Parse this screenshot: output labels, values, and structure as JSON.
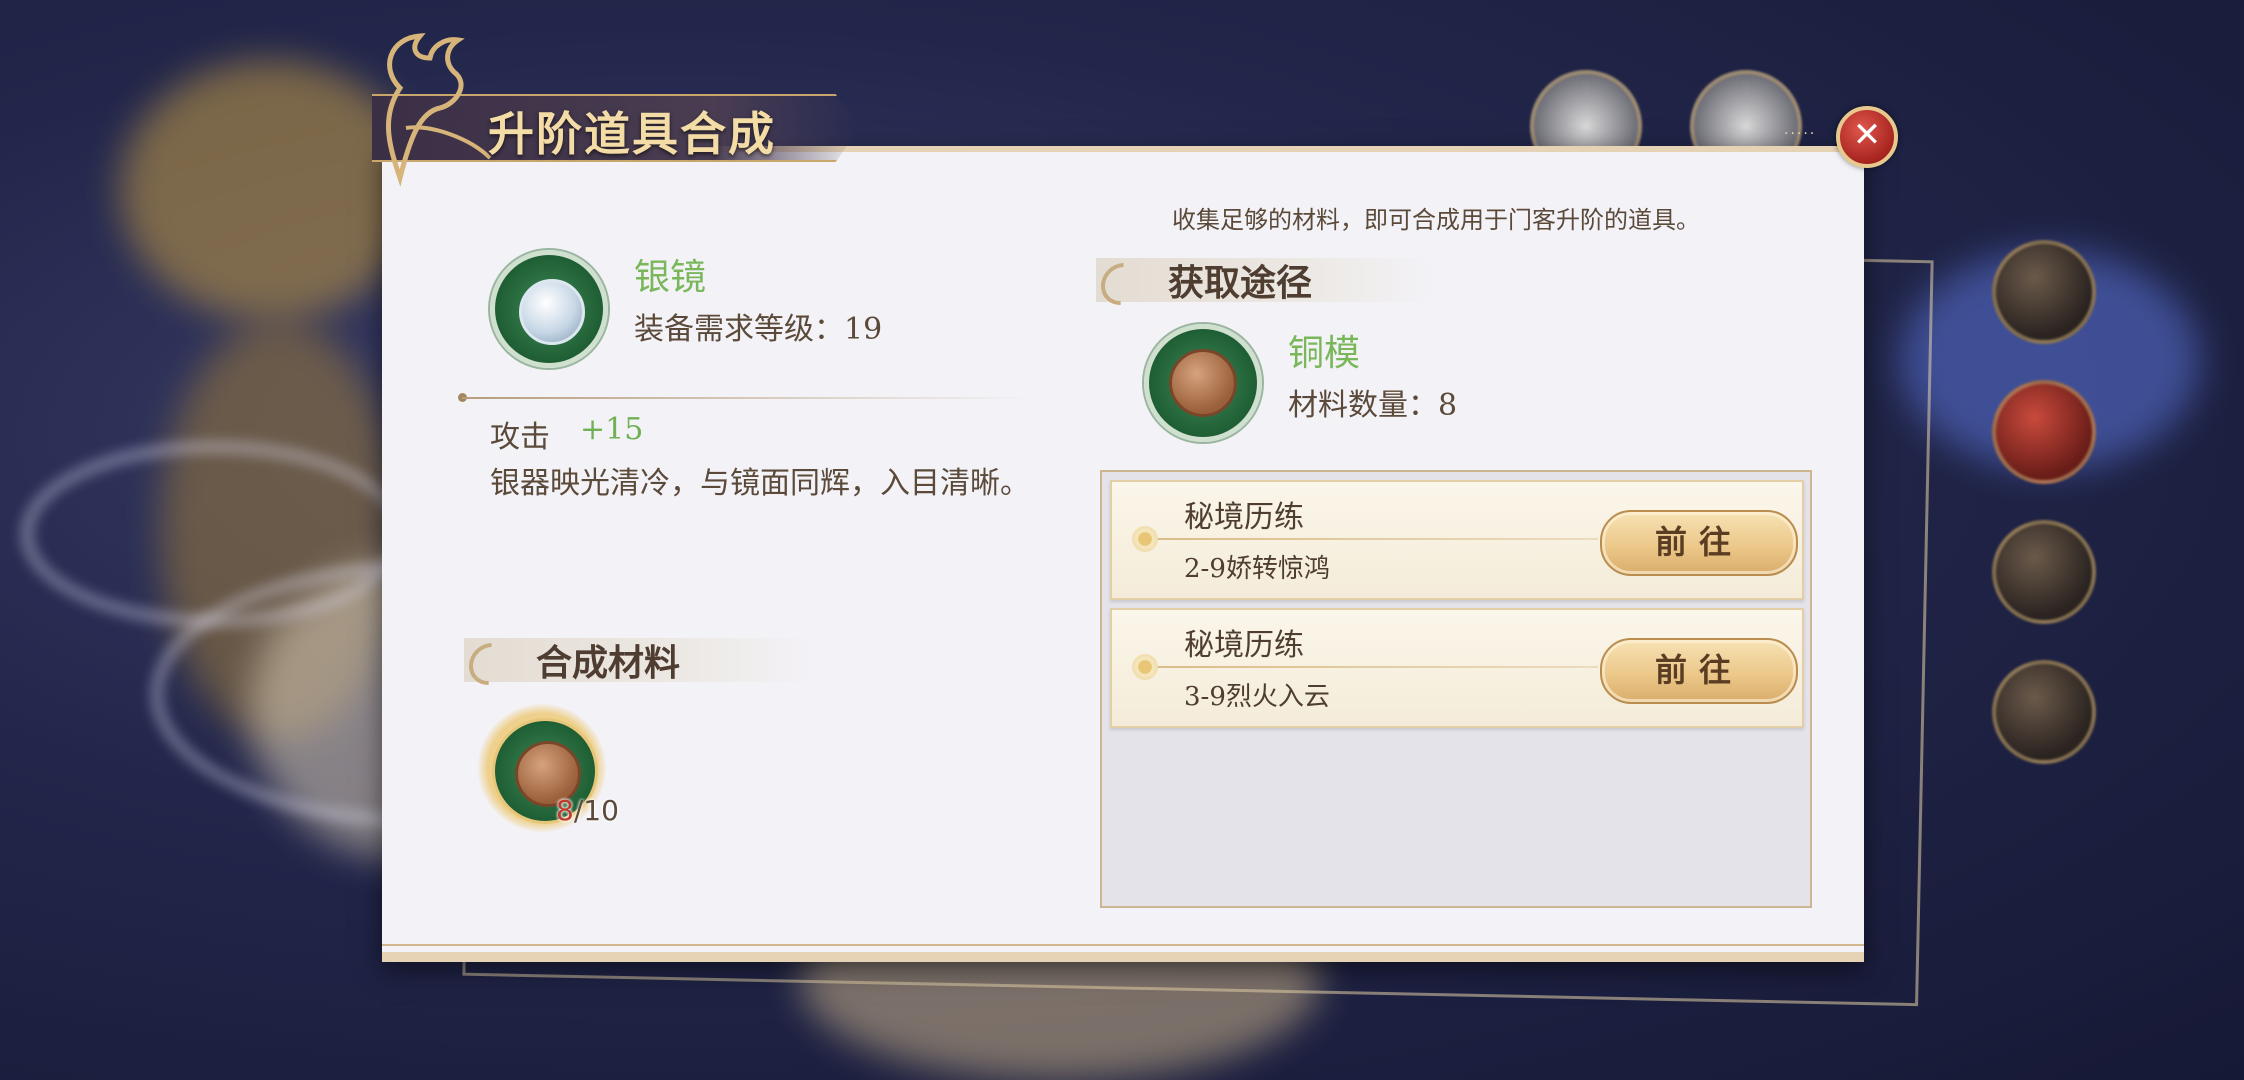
{
  "dialog": {
    "title": "升阶道具合成",
    "hint": "收集足够的材料，即可合成用于门客升阶的道具。",
    "close_label": "✕"
  },
  "item": {
    "name": "银镜",
    "level_label": "装备需求等级：19",
    "attribute_label": "攻击",
    "attribute_value": "+15",
    "description": "银器映光清冷，与镜面同辉，入目清晰。"
  },
  "materials": {
    "header": "合成材料",
    "items": [
      {
        "icon": "copper-mold-icon",
        "have": "8",
        "need": "/10"
      }
    ]
  },
  "sources": {
    "header": "获取途径",
    "material_name": "铜模",
    "material_qty_label": "材料数量：8",
    "routes": [
      {
        "title": "秘境历练",
        "stage": "2-9娇转惊鸿",
        "button": "前往"
      },
      {
        "title": "秘境历练",
        "stage": "3-9烈火入云",
        "button": "前往"
      }
    ]
  },
  "colors": {
    "item_name_green": "#7ab75a",
    "text_brown": "#5b4a3a",
    "count_red": "#c0392b",
    "gold": "#e7c98d"
  }
}
